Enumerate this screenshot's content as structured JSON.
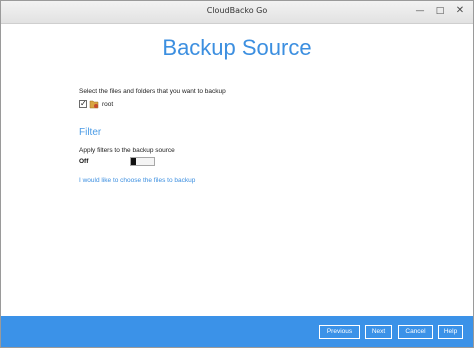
{
  "window": {
    "title": "CloudBacko Go"
  },
  "page": {
    "title": "Backup Source"
  },
  "source": {
    "instruction": "Select the files and folders that you want to backup",
    "items": [
      {
        "label": "root",
        "checked": true
      }
    ]
  },
  "filter": {
    "heading": "Filter",
    "description": "Apply filters to the backup source",
    "state_label": "Off",
    "enabled": false
  },
  "link": {
    "text": "I would like to choose the files to backup"
  },
  "footer": {
    "previous_label": "Previous",
    "next_label": "Next",
    "cancel_label": "Cancel",
    "help_label": "Help"
  },
  "colors": {
    "accent": "#3c8fe0",
    "footer_bg": "#3b92e8"
  }
}
